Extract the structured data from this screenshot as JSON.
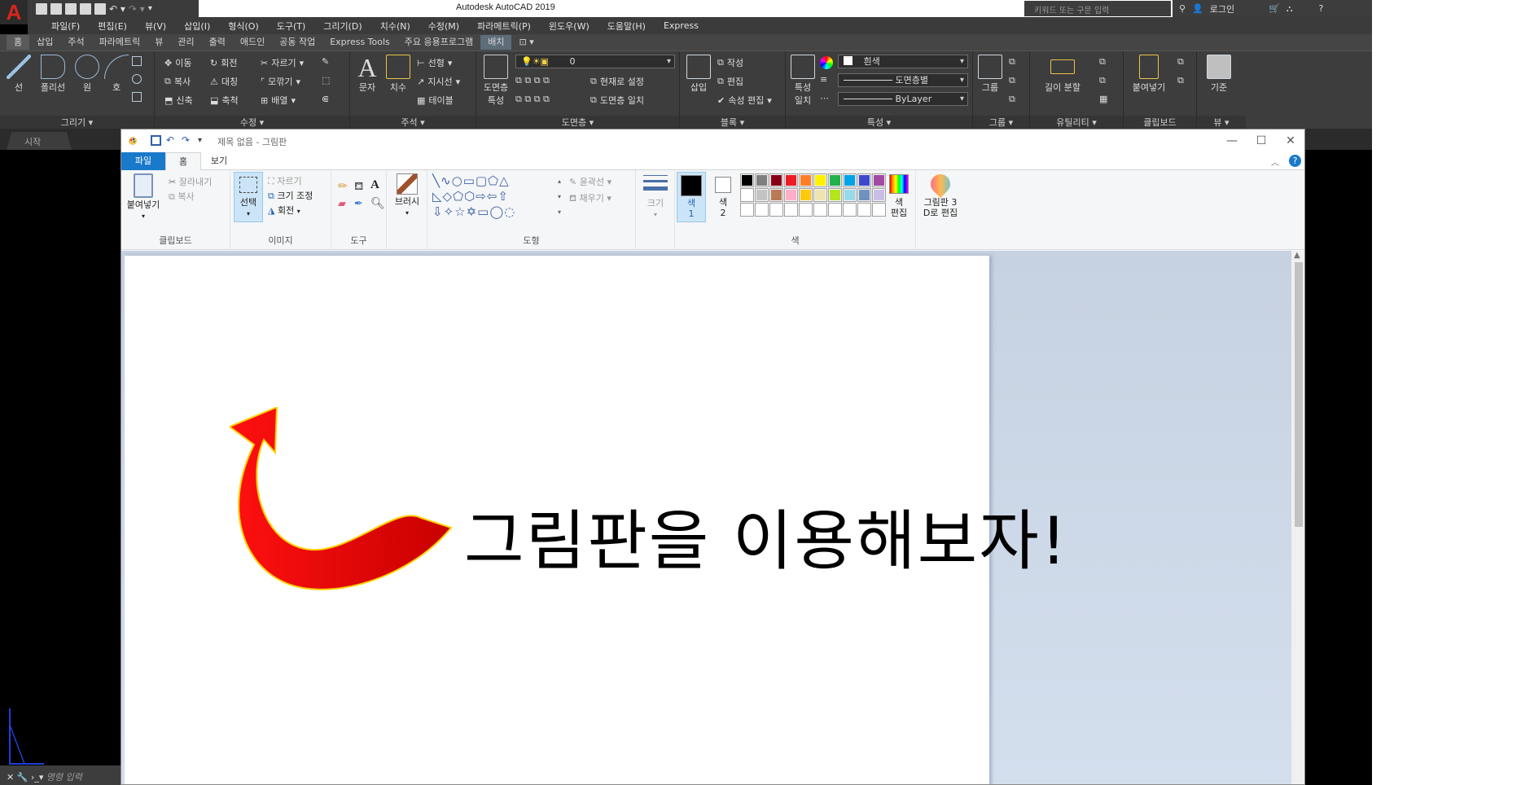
{
  "acad": {
    "app_title": "Autodesk AutoCAD 2019",
    "search_placeholder": "키워드 또는 구문 입력",
    "login": "로그인",
    "menu": [
      "파일(F)",
      "편집(E)",
      "뷰(V)",
      "삽입(I)",
      "형식(O)",
      "도구(T)",
      "그리기(D)",
      "치수(N)",
      "수정(M)",
      "파라메트릭(P)",
      "윈도우(W)",
      "도움말(H)",
      "Express"
    ],
    "ribbon_tabs": [
      "홈",
      "삽입",
      "주석",
      "파라메트릭",
      "뷰",
      "관리",
      "출력",
      "애드인",
      "공동 작업",
      "Express Tools",
      "주요 응용프로그램",
      "배치"
    ],
    "panels": {
      "draw": {
        "label": "그리기 ▾",
        "line": "선",
        "polyline": "폴리선",
        "circle": "원",
        "arc": "호"
      },
      "modify": {
        "label": "수정 ▾",
        "move": "이동",
        "rotate": "회전",
        "trim": "자르기",
        "copy": "복사",
        "mirror": "대칭",
        "fillet": "모깎기",
        "stretch": "신축",
        "scale": "축척",
        "array": "배열"
      },
      "annotation": {
        "label": "주석 ▾",
        "text": "문자",
        "dimension": "치수",
        "linear": "선형",
        "leader": "지시선",
        "table": "테이블"
      },
      "layers": {
        "label": "도면층 ▾",
        "props": "도면층 특성",
        "current_layer": "0",
        "set_current": "현재로 설정",
        "match_layer": "도면층 일치"
      },
      "block": {
        "label": "블록 ▾",
        "insert": "삽입",
        "create": "작성",
        "edit": "편집",
        "attr_edit": "속성 편집"
      },
      "properties": {
        "label": "특성 ▾",
        "match": "특성 일치",
        "color": "흰색",
        "linetype": "도면층별",
        "lineweight": "ByLayer"
      },
      "groups": {
        "label": "그룹 ▾",
        "group": "그룹"
      },
      "utilities": {
        "label": "유틸리티 ▾",
        "measure": "길이 분할"
      },
      "clipboard": {
        "label": "클립보드",
        "paste": "붙여넣기"
      },
      "view": {
        "label": "뷰 ▾",
        "base": "기준"
      }
    },
    "start_tab": "시작",
    "command_placeholder": "명령 입력"
  },
  "paint": {
    "window_title": "제목 없음 - 그림판",
    "tabs": {
      "file": "파일",
      "home": "홈",
      "view": "보기"
    },
    "clipboard": {
      "label": "클립보드",
      "paste": "붙여넣기",
      "cut": "잘라내기",
      "copy": "복사"
    },
    "image": {
      "label": "이미지",
      "select": "선택",
      "crop": "자르기",
      "resize": "크기 조정",
      "rotate": "회전"
    },
    "tools": {
      "label": "도구"
    },
    "brushes": "브러시",
    "shapes": {
      "label": "도형",
      "outline": "윤곽선",
      "fill": "채우기"
    },
    "size": "크기",
    "color1": "색\n1",
    "color2": "색\n2",
    "colors_label": "색",
    "edit_colors": "색\n편집",
    "paint3d": "그림판 3\nD로 편집",
    "canvas_text": "그림판을 이용해보자!",
    "palette": [
      "#000000",
      "#7f7f7f",
      "#880015",
      "#ed1c24",
      "#ff7f27",
      "#fff200",
      "#22b14c",
      "#00a2e8",
      "#3f48cc",
      "#a349a4",
      "#ffffff",
      "#c3c3c3",
      "#b97a57",
      "#ffaec9",
      "#ffc90e",
      "#efe4b0",
      "#b5e61d",
      "#99d9ea",
      "#7092be",
      "#c8bfe7"
    ],
    "primary_color": "#000000",
    "secondary_color": "#ffffff",
    "arrow_color": "#e00000"
  }
}
